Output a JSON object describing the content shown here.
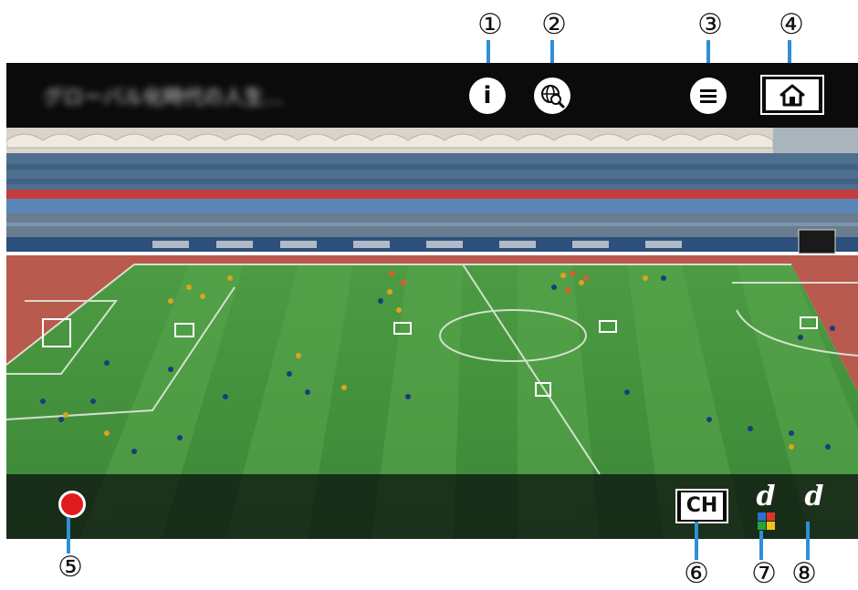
{
  "callouts": {
    "c1": "①",
    "c2": "②",
    "c3": "③",
    "c4": "④",
    "c5": "⑤",
    "c6": "⑥",
    "c7": "⑦",
    "c8": "⑧"
  },
  "header": {
    "title": "グローバル化時代の人生…"
  },
  "toolbar": {
    "info_glyph": "i",
    "channel_label": "CH",
    "d_button_letter": "d",
    "d_plain_letter": "d"
  },
  "colors": {
    "bar": "#0b0b0b",
    "accent_line": "#2f8fd6",
    "record_red": "#e01b1b",
    "pitch_green": "#3f8f3a"
  },
  "icons": [
    "info-icon",
    "globe-search-icon",
    "menu-icon",
    "home-icon",
    "record-icon",
    "channel-icon",
    "d-button-icon",
    "d-icon"
  ]
}
